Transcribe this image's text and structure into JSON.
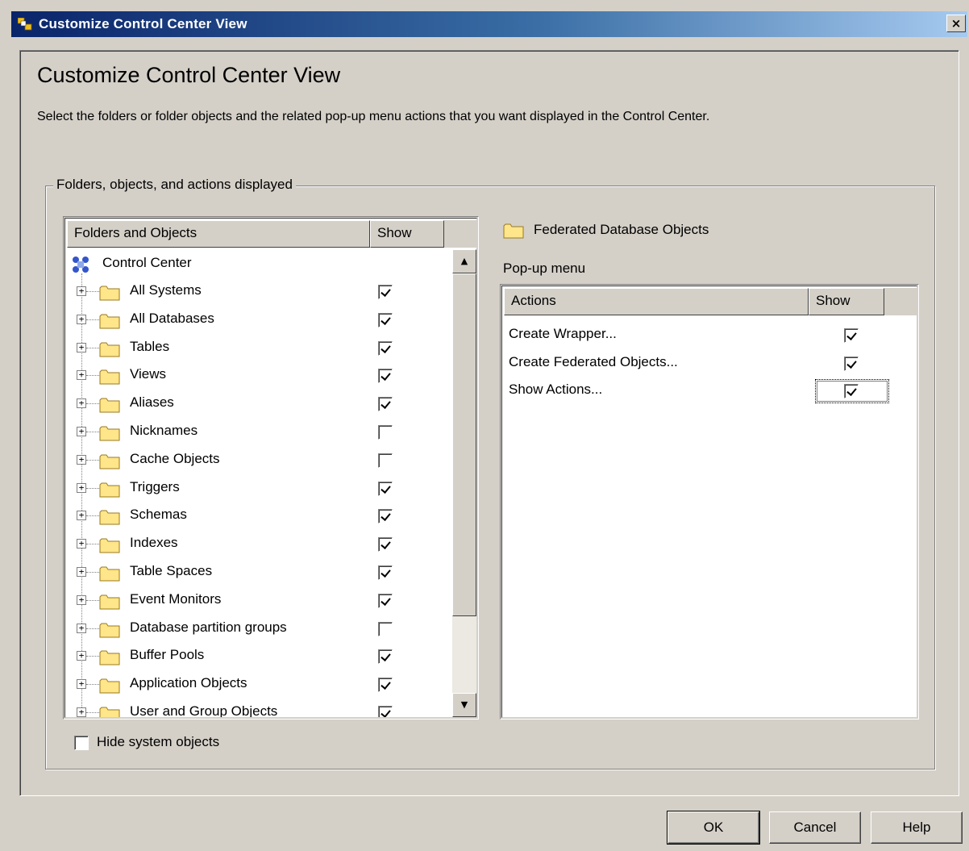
{
  "window": {
    "title": "Customize Control Center View",
    "close_label": "×"
  },
  "header": {
    "heading": "Customize Control Center View",
    "description": "Select the folders or folder objects and the related pop-up menu actions that you want displayed in the Control Center."
  },
  "groupbox": {
    "legend": "Folders, objects, and actions displayed"
  },
  "tree": {
    "columns": {
      "name": "Folders and Objects",
      "show": "Show"
    },
    "root_label": "Control Center",
    "items": [
      {
        "label": "All Systems",
        "show": true
      },
      {
        "label": "All Databases",
        "show": true
      },
      {
        "label": "Tables",
        "show": true
      },
      {
        "label": "Views",
        "show": true
      },
      {
        "label": "Aliases",
        "show": true
      },
      {
        "label": "Nicknames",
        "show": false
      },
      {
        "label": "Cache Objects",
        "show": false
      },
      {
        "label": "Triggers",
        "show": true
      },
      {
        "label": "Schemas",
        "show": true
      },
      {
        "label": "Indexes",
        "show": true
      },
      {
        "label": "Table Spaces",
        "show": true
      },
      {
        "label": "Event Monitors",
        "show": true
      },
      {
        "label": "Database partition groups",
        "show": false
      },
      {
        "label": "Buffer Pools",
        "show": true
      },
      {
        "label": "Application Objects",
        "show": true
      },
      {
        "label": "User and Group Objects",
        "show": true
      }
    ]
  },
  "hide_system_objects": {
    "label": "Hide system objects",
    "checked": false
  },
  "selected_folder": {
    "label": "Federated Database Objects"
  },
  "popup_menu": {
    "label": "Pop-up menu",
    "columns": {
      "actions": "Actions",
      "show": "Show"
    },
    "actions": [
      {
        "label": "Create Wrapper...",
        "show": true
      },
      {
        "label": "Create Federated Objects...",
        "show": true
      },
      {
        "label": "Show Actions...",
        "show": true
      }
    ]
  },
  "buttons": {
    "ok": "OK",
    "cancel": "Cancel",
    "help": "Help"
  }
}
